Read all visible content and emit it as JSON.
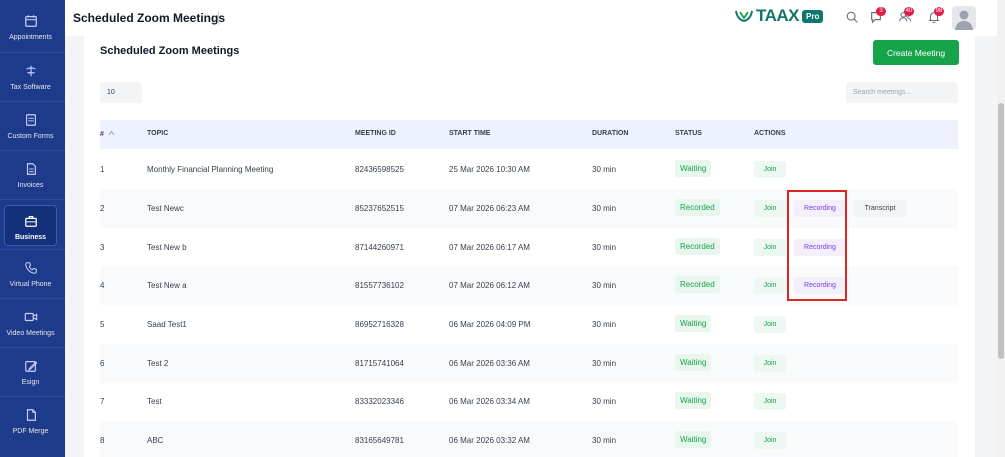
{
  "sidebar": {
    "items": [
      {
        "label": "Appointments",
        "icon": "calendar-icon"
      },
      {
        "label": "Tax Software",
        "icon": "tax-software-icon"
      },
      {
        "label": "Custom Forms",
        "icon": "form-icon"
      },
      {
        "label": "Invoices",
        "icon": "invoice-icon"
      },
      {
        "label": "Business",
        "icon": "briefcase-icon"
      },
      {
        "label": "Virtual Phone",
        "icon": "phone-icon"
      },
      {
        "label": "Video Meetings",
        "icon": "video-icon"
      },
      {
        "label": "Esign",
        "icon": "esign-icon"
      },
      {
        "label": "PDF Merge",
        "icon": "pdf-merge-icon"
      }
    ],
    "active": "Business"
  },
  "header": {
    "title": "Scheduled Zoom Meetings",
    "logo_text": "TAAX",
    "logo_badge": "Pro",
    "messages_count": "3",
    "users_count": "40",
    "notifications_count": "98"
  },
  "page": {
    "title": "Scheduled Zoom Meetings",
    "create_label": "Create Meeting",
    "page_size": "10",
    "search_placeholder": "Search meetings..."
  },
  "table": {
    "columns": [
      "#",
      "TOPIC",
      "MEETING ID",
      "START TIME",
      "DURATION",
      "STATUS",
      "ACTIONS"
    ],
    "rows": [
      {
        "num": "1",
        "topic": "Monthly Financial Planning Meeting",
        "meeting_id": "82436598525",
        "start": "25 Mar 2026 10:30 AM",
        "duration": "30 min",
        "status": "Waiting",
        "join": "Join"
      },
      {
        "num": "2",
        "topic": "Test Newc",
        "meeting_id": "85237652515",
        "start": "07 Mar 2026 06:23 AM",
        "duration": "30 min",
        "status": "Recorded",
        "join": "Join",
        "recording": "Recording",
        "transcript": "Transcript"
      },
      {
        "num": "3",
        "topic": "Test New b",
        "meeting_id": "87144260971",
        "start": "07 Mar 2026 06:17 AM",
        "duration": "30 min",
        "status": "Recorded",
        "join": "Join",
        "recording": "Recording"
      },
      {
        "num": "4",
        "topic": "Test New a",
        "meeting_id": "81557736102",
        "start": "07 Mar 2026 06:12 AM",
        "duration": "30 min",
        "status": "Recorded",
        "join": "Join",
        "recording": "Recording"
      },
      {
        "num": "5",
        "topic": "Saad Test1",
        "meeting_id": "86952716328",
        "start": "06 Mar 2026 04:09 PM",
        "duration": "30 min",
        "status": "Waiting",
        "join": "Join"
      },
      {
        "num": "6",
        "topic": "Test 2",
        "meeting_id": "81715741064",
        "start": "06 Mar 2026 03:36 AM",
        "duration": "30 min",
        "status": "Waiting",
        "join": "Join"
      },
      {
        "num": "7",
        "topic": "Test",
        "meeting_id": "83332023346",
        "start": "06 Mar 2026 03:34 AM",
        "duration": "30 min",
        "status": "Waiting",
        "join": "Join"
      },
      {
        "num": "8",
        "topic": "ABC",
        "meeting_id": "83165649781",
        "start": "06 Mar 2026 03:32 AM",
        "duration": "30 min",
        "status": "Waiting",
        "join": "Join"
      }
    ]
  },
  "colors": {
    "sidebar_bg": "#1e3a8a",
    "accent_green": "#16a34a",
    "recording_purple": "#7c3aed",
    "highlight_red": "#dc2626"
  }
}
